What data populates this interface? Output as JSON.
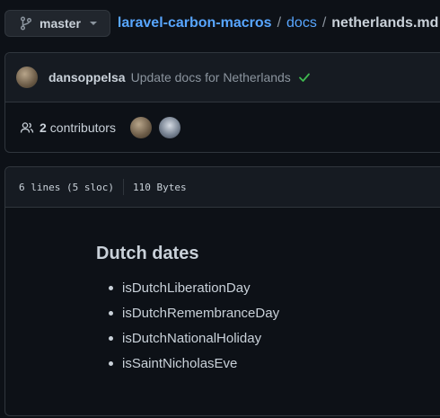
{
  "branch": {
    "name": "master"
  },
  "breadcrumb": {
    "repo": "laravel-carbon-macros",
    "sep1": "/",
    "folder": "docs",
    "sep2": "/",
    "file": "netherlands.md"
  },
  "commit": {
    "author": "dansoppelsa",
    "message": "Update docs for Netherlands",
    "status": "success"
  },
  "contributors": {
    "count": "2",
    "label": "contributors"
  },
  "file_info": {
    "lines": "6 lines (5 sloc)",
    "size": "110 Bytes"
  },
  "markdown": {
    "heading": "Dutch dates",
    "items": [
      "isDutchLiberationDay",
      "isDutchRemembranceDay",
      "isDutchNationalHoliday",
      "isSaintNicholasEve"
    ]
  },
  "colors": {
    "link": "#58a6ff",
    "success": "#3fb950",
    "bg": "#0d1117",
    "panel": "#161b22",
    "border": "#30363d"
  }
}
